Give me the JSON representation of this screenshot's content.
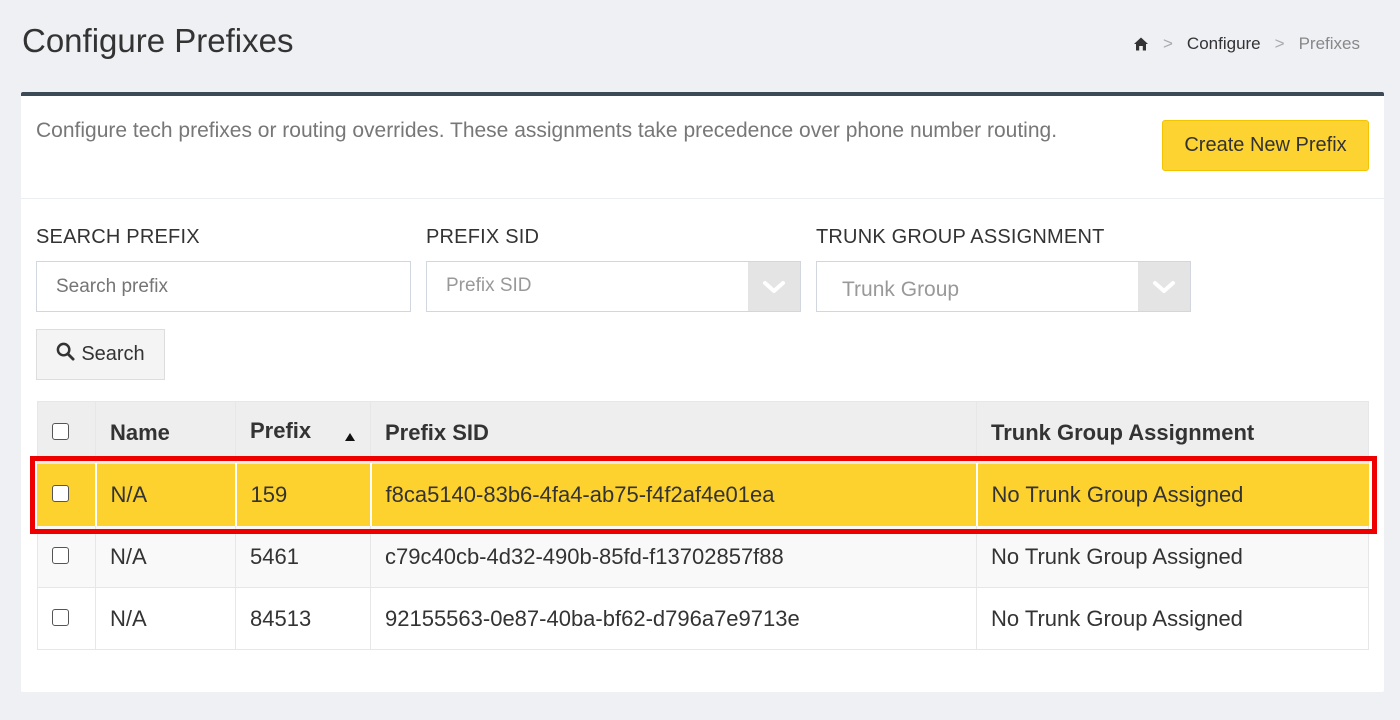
{
  "page": {
    "title": "Configure Prefixes"
  },
  "breadcrumb": {
    "home_icon": "home-icon",
    "items": [
      "Configure",
      "Prefixes"
    ],
    "separator": ">"
  },
  "panel": {
    "description": "Configure tech prefixes or routing overrides. These assignments take precedence over phone number routing.",
    "create_button_label": "Create New Prefix"
  },
  "filters": {
    "search_prefix": {
      "label": "SEARCH PREFIX",
      "placeholder": "Search prefix"
    },
    "prefix_sid": {
      "label": "PREFIX SID",
      "placeholder": "Prefix SID"
    },
    "trunk_group": {
      "label": "TRUNK GROUP ASSIGNMENT",
      "placeholder": "Trunk Group"
    },
    "search_button_label": "Search",
    "search_icon": "search-icon"
  },
  "table": {
    "columns": [
      "Name",
      "Prefix",
      "Prefix SID",
      "Trunk Group Assignment"
    ],
    "sort_column": "Prefix",
    "sort_direction": "ascending",
    "rows": [
      {
        "name": "N/A",
        "prefix": "159",
        "sid": "f8ca5140-83b6-4fa4-ab75-f4f2af4e01ea",
        "trunk": "No Trunk Group Assigned",
        "highlighted": true
      },
      {
        "name": "N/A",
        "prefix": "5461",
        "sid": "c79c40cb-4d32-490b-85fd-f13702857f88",
        "trunk": "No Trunk Group Assigned",
        "highlighted": false
      },
      {
        "name": "N/A",
        "prefix": "84513",
        "sid": "92155563-0e87-40ba-bf62-d796a7e9713e",
        "trunk": "No Trunk Group Assigned",
        "highlighted": false
      }
    ]
  },
  "colors": {
    "accent_yellow": "#fdd331",
    "highlight_border": "#ee0000",
    "panel_top_border": "#3c4a56"
  }
}
